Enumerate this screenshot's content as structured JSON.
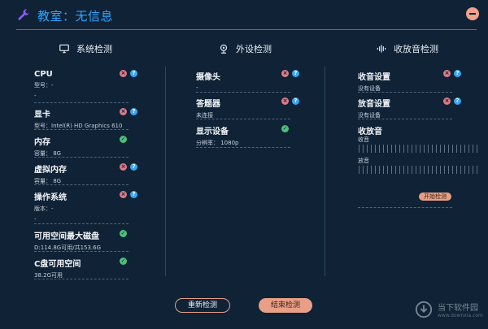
{
  "title": "教室：无信息",
  "columns": {
    "system": "系统检测",
    "peripheral": "外设检测",
    "audio": "收放音检测"
  },
  "system": {
    "cpu": {
      "title": "CPU",
      "sub": "型号：-",
      "dash": "-"
    },
    "gpu": {
      "title": "显卡",
      "sub": "型号：Intel(R) HD Graphics 610"
    },
    "ram": {
      "title": "内存",
      "sub": "容量：  8G"
    },
    "vram": {
      "title": "虚拟内存",
      "sub": "容量：  8G"
    },
    "os": {
      "title": "操作系统",
      "sub": "版本：-",
      "dash": "-"
    },
    "disk": {
      "title": "可用空间最大磁盘",
      "sub": "D:114.8G可用/共153.6G"
    },
    "cdrive": {
      "title": "C盘可用空间",
      "sub": "38.2G可用"
    }
  },
  "peripheral": {
    "camera": {
      "title": "摄像头",
      "sub": "-"
    },
    "responder": {
      "title": "答题器",
      "sub": "未连接"
    },
    "display": {
      "title": "显示设备",
      "sub": "分辨率：  1080p"
    }
  },
  "audio": {
    "record": {
      "title": "收音设置",
      "sub": "没有设备"
    },
    "playback": {
      "title": "放音设置",
      "sub": "没有设备"
    },
    "levels": {
      "title": "收放音",
      "record_label": "收音",
      "play_label": "放音"
    },
    "start_button": "开始检测"
  },
  "buttons": {
    "recheck": "重新检测",
    "finish": "结束检测"
  },
  "watermark": {
    "line1": "当下软件园",
    "line2": "www.downxia.com"
  },
  "colors": {
    "background": "#0f2236",
    "accent": "#2fa6ff",
    "button": "#e89f86",
    "error": "#e07a85",
    "help": "#3aa6f0",
    "ok": "#4dbf7a"
  },
  "icons": {
    "title": "wrench-icon",
    "system": "monitor-icon",
    "peripheral": "webcam-icon",
    "audio": "sound-wave-icon"
  }
}
